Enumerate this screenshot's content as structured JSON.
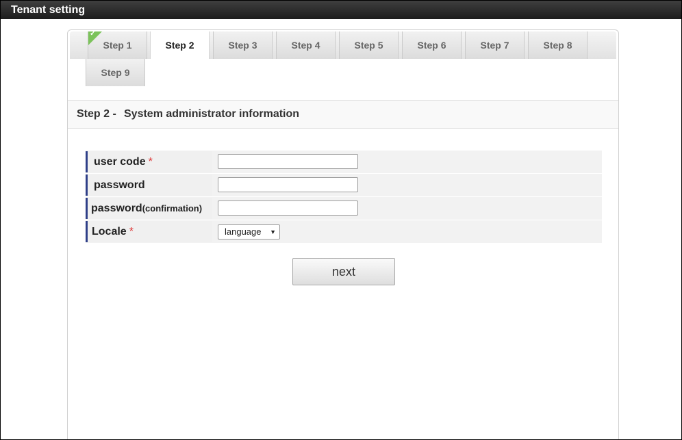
{
  "window": {
    "title": "Tenant setting"
  },
  "tabs": [
    {
      "label": "Step 1",
      "completed": true,
      "active": false
    },
    {
      "label": "Step 2",
      "completed": false,
      "active": true
    },
    {
      "label": "Step 3",
      "completed": false,
      "active": false
    },
    {
      "label": "Step 4",
      "completed": false,
      "active": false
    },
    {
      "label": "Step 5",
      "completed": false,
      "active": false
    },
    {
      "label": "Step 6",
      "completed": false,
      "active": false
    },
    {
      "label": "Step 7",
      "completed": false,
      "active": false
    },
    {
      "label": "Step 8",
      "completed": false,
      "active": false
    },
    {
      "label": "Step 9",
      "completed": false,
      "active": false
    }
  ],
  "section": {
    "step": "Step 2 -",
    "title": "System administrator information"
  },
  "form": {
    "user_code": {
      "label": "user code",
      "required": "*",
      "value": ""
    },
    "password": {
      "label": "password",
      "value": ""
    },
    "password_confirm": {
      "label": "password",
      "suffix": "(confirmation)",
      "value": ""
    },
    "locale": {
      "label": "Locale",
      "required": "*",
      "selected": "language"
    }
  },
  "actions": {
    "next_label": "next"
  },
  "colors": {
    "completed_check": "#7cc35b",
    "label_accent": "#2f3f88",
    "required": "#dd3333"
  }
}
